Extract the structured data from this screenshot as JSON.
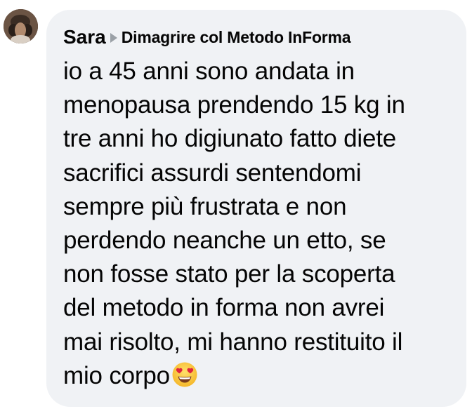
{
  "comment": {
    "author": "Sara",
    "group": "Dimagrire col Metodo InForma",
    "lines": [
      "io a 45 anni sono andata in",
      "menopausa prendendo 15 kg in",
      "tre anni ho digiunato fatto diete",
      "sacrifici assurdi sentendomi",
      "sempre più frustrata e non",
      "perdendo neanche un etto, se",
      "non fosse stato per la scoperta",
      "del metodo in forma non avrei",
      "mai risolto, mi hanno restituito il",
      "mio corpo"
    ],
    "emoji": "heart-eyes-emoji"
  },
  "colors": {
    "bubble_bg": "#f0f2f5",
    "text": "#050505",
    "arrow": "#9aa0a6"
  }
}
